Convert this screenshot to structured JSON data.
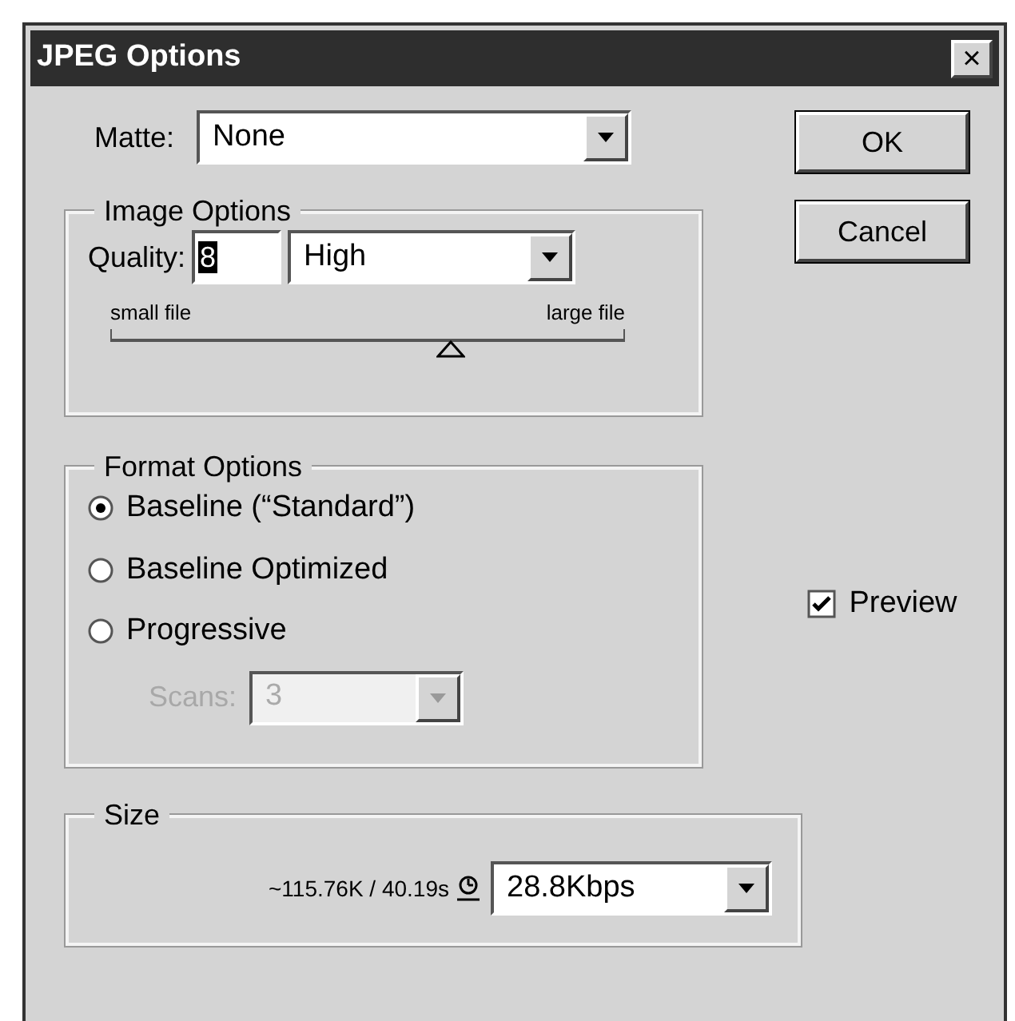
{
  "window": {
    "title": "JPEG Options",
    "close": "×"
  },
  "matte": {
    "label": "Matte:",
    "value": "None"
  },
  "buttons": [
    "OK",
    "Cancel"
  ],
  "image_options": {
    "title": "Image Options",
    "quality_label": "Quality:",
    "quality_value": "8",
    "quality_preset": "High",
    "slider_min_label": "small file",
    "slider_max_label": "large file",
    "level": 0.66
  },
  "format_options": {
    "title": "Format Options",
    "choices": [
      {
        "label": "Baseline (“Standard”)",
        "selected": true
      },
      {
        "label": "Baseline Optimized",
        "selected": false
      },
      {
        "label": "Progressive",
        "selected": false
      }
    ],
    "scans": {
      "label": "Scans:",
      "value": "3",
      "disabled": true
    }
  },
  "preview": {
    "label": "Preview",
    "checked": true
  },
  "size": {
    "title": "Size",
    "estimate": "~115.76K / 40.19s",
    "speed": "28.8Kbps"
  }
}
